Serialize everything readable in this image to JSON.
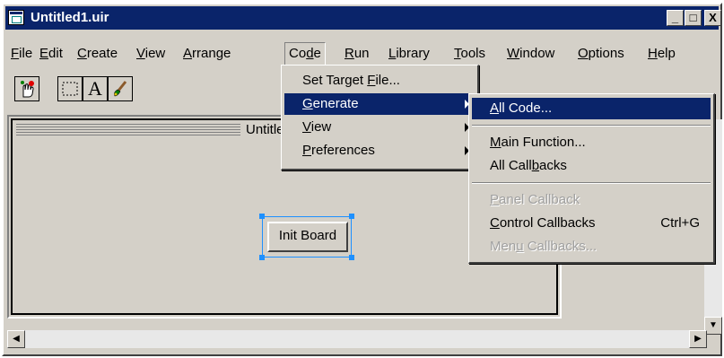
{
  "window": {
    "title": "Untitled1.uir",
    "min_label": "_",
    "max_label": "□",
    "close_label": "X"
  },
  "menubar": {
    "items": [
      {
        "pre": "",
        "u": "F",
        "post": "ile"
      },
      {
        "pre": "",
        "u": "E",
        "post": "dit"
      },
      {
        "pre": "",
        "u": "C",
        "post": "reate"
      },
      {
        "pre": "",
        "u": "V",
        "post": "iew"
      },
      {
        "pre": "",
        "u": "A",
        "post": "rrange"
      },
      {
        "pre": "Co",
        "u": "d",
        "post": "e"
      },
      {
        "pre": "",
        "u": "R",
        "post": "un"
      },
      {
        "pre": "",
        "u": "L",
        "post": "ibrary"
      },
      {
        "pre": "",
        "u": "T",
        "post": "ools"
      },
      {
        "pre": "",
        "u": "W",
        "post": "indow"
      },
      {
        "pre": "",
        "u": "O",
        "post": "ptions"
      },
      {
        "pre": "",
        "u": "H",
        "post": "elp"
      }
    ]
  },
  "toolbar": {
    "tools": [
      "operate-tool",
      "select-tool",
      "text-tool",
      "color-tool"
    ],
    "text_tool_label": "A"
  },
  "panel": {
    "title": "Untitle",
    "button_label": "Init Board"
  },
  "code_menu": {
    "items": [
      {
        "pre": "Set Target ",
        "u": "F",
        "post": "ile..."
      },
      {
        "pre": "",
        "u": "G",
        "post": "enerate"
      },
      {
        "pre": "",
        "u": "V",
        "post": "iew"
      },
      {
        "pre": "",
        "u": "P",
        "post": "references"
      }
    ]
  },
  "generate_menu": {
    "items": [
      {
        "pre": "",
        "u": "A",
        "post": "ll Code...",
        "shortcut": ""
      },
      {
        "pre": "",
        "u": "M",
        "post": "ain Function...",
        "shortcut": ""
      },
      {
        "pre": "All Call",
        "u": "b",
        "post": "acks",
        "shortcut": ""
      },
      {
        "pre": "",
        "u": "P",
        "post": "anel Callback",
        "shortcut": ""
      },
      {
        "pre": "",
        "u": "C",
        "post": "ontrol Callbacks",
        "shortcut": "Ctrl+G"
      },
      {
        "pre": "Men",
        "u": "u",
        "post": " Callbacks...",
        "shortcut": ""
      }
    ]
  },
  "colors": {
    "highlight": "#0a246a",
    "face": "#d4d0c8",
    "selection_handles": "#1e90ff"
  }
}
